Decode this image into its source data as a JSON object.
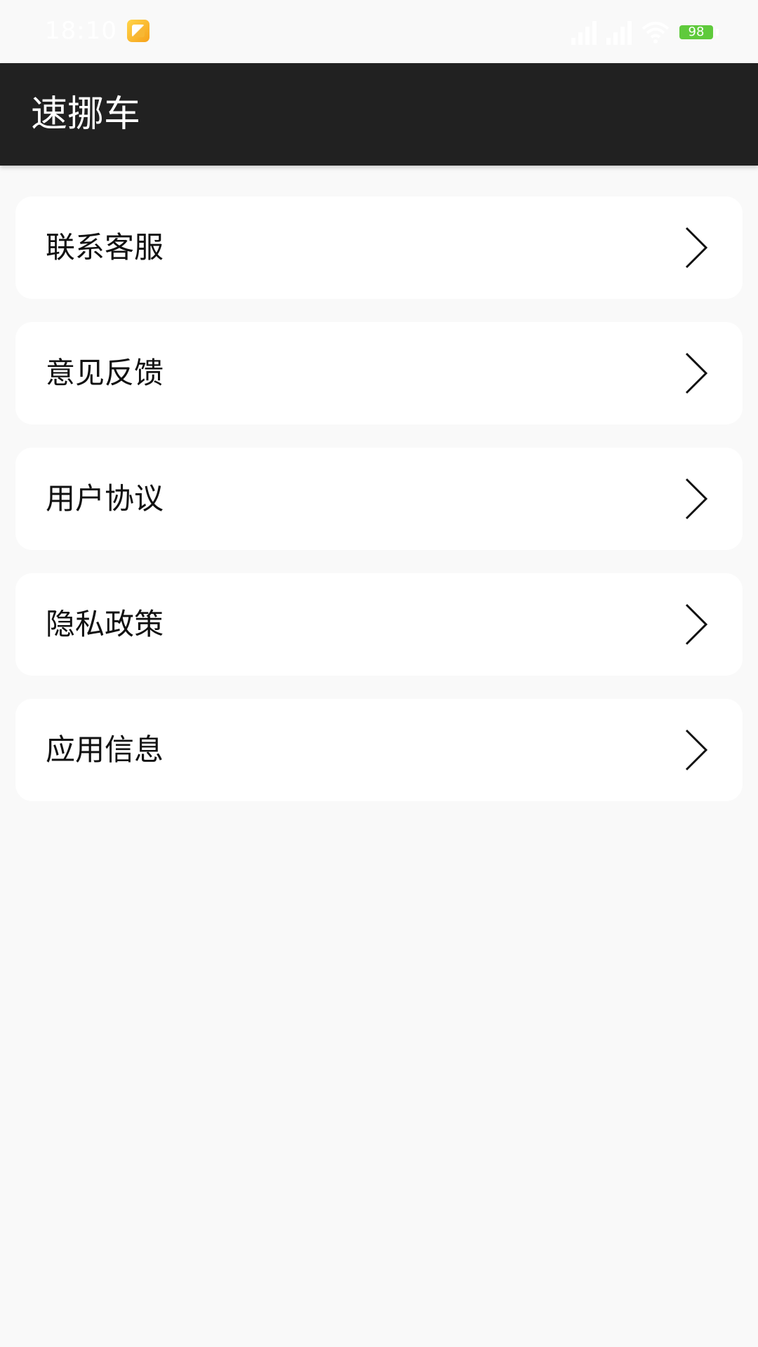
{
  "status_bar": {
    "time": "18:10",
    "battery_level": "98",
    "icons": [
      "app-notification-icon",
      "signal-icon",
      "wifi-icon",
      "battery-icon"
    ]
  },
  "app_bar": {
    "title": "速挪车"
  },
  "menu": {
    "items": [
      {
        "label": "联系客服",
        "icon": "chevron-right-icon"
      },
      {
        "label": "意见反馈",
        "icon": "chevron-right-icon"
      },
      {
        "label": "用户协议",
        "icon": "chevron-right-icon"
      },
      {
        "label": "隐私政策",
        "icon": "chevron-right-icon"
      },
      {
        "label": "应用信息",
        "icon": "chevron-right-icon"
      }
    ]
  },
  "colors": {
    "app_bar_bg": "#212121",
    "page_bg": "#f9f9f9",
    "card_bg": "#ffffff",
    "battery": "#5fca3c"
  }
}
